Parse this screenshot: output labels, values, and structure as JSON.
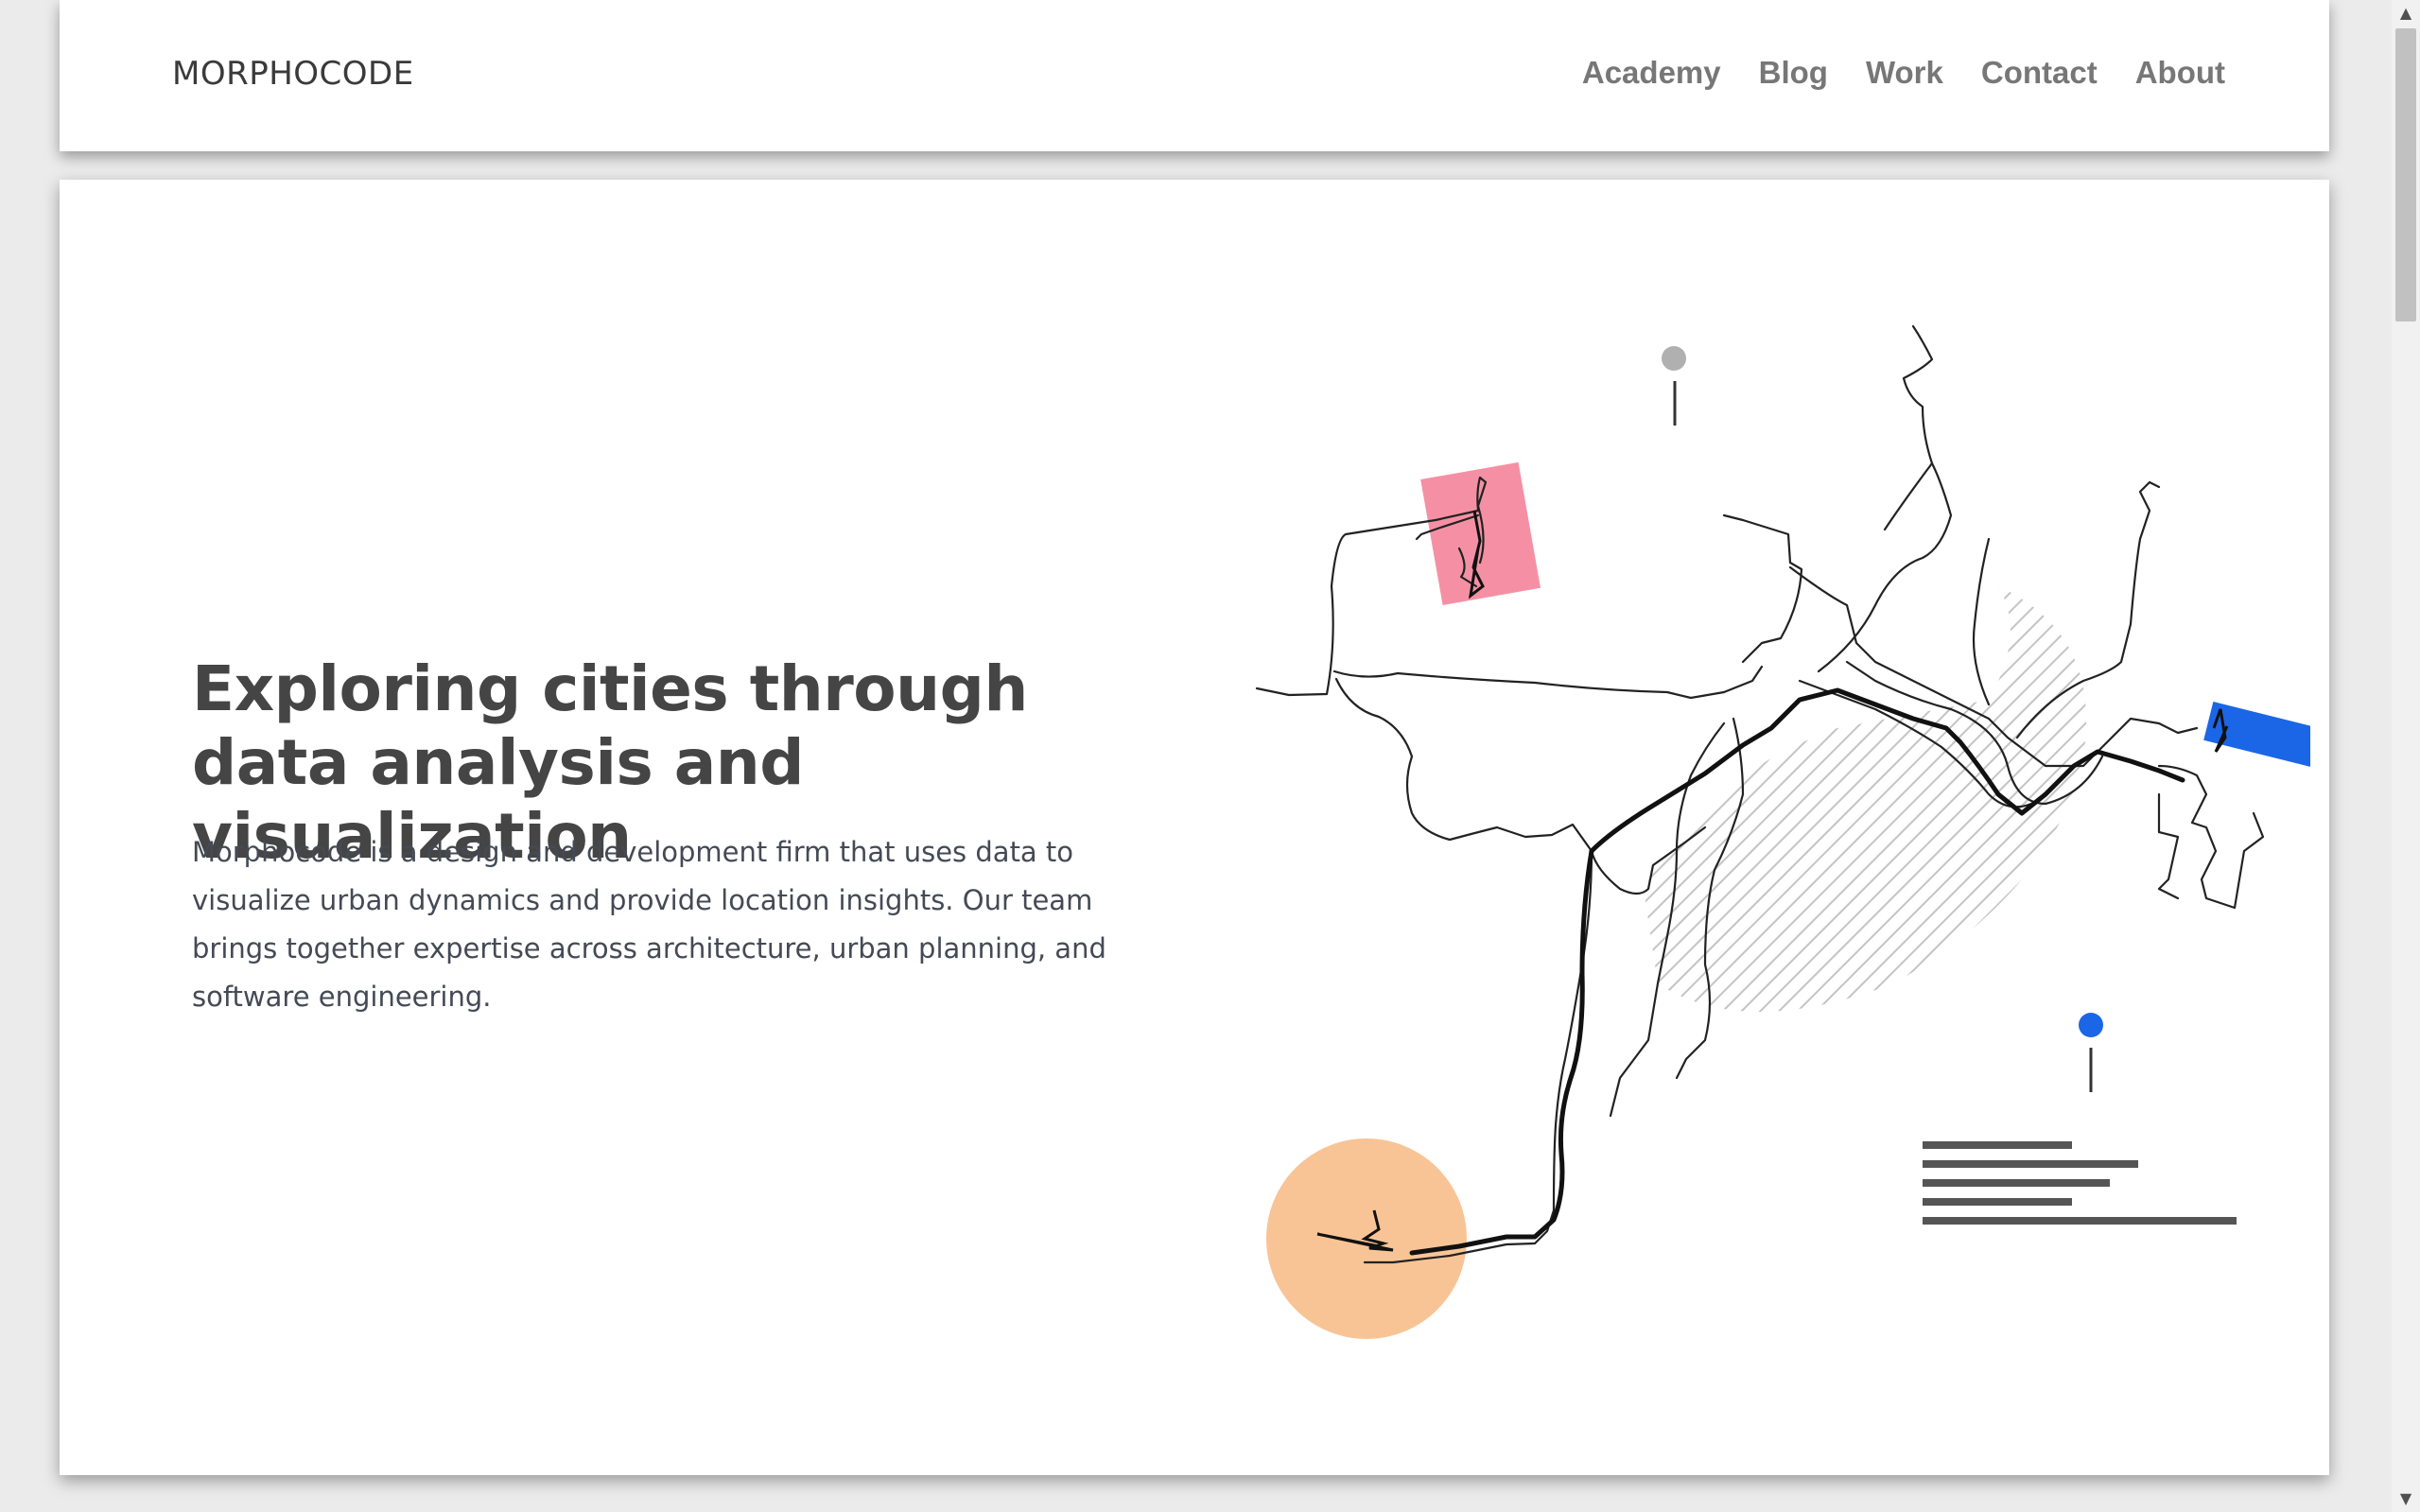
{
  "header": {
    "logo": "MORPHOCODE",
    "nav": [
      "Academy",
      "Blog",
      "Work",
      "Contact",
      "About"
    ]
  },
  "hero": {
    "title": "Exploring cities through data analysis and visualization",
    "description": "Morphocode is a design and development firm that uses data to visualize urban dynamics and provide location insights. Our team brings together expertise across architecture, urban planning, and software engineering."
  },
  "colors": {
    "pink": "#f4849a",
    "blue": "#1a66e6",
    "orange": "#f8be8a",
    "hatch": "#bdbdbd",
    "route": "#222222",
    "pin_gray": "#b0b0b0"
  }
}
